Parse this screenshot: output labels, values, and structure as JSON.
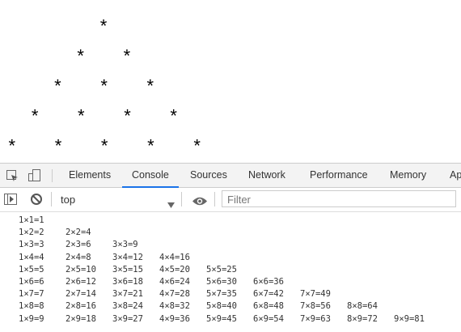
{
  "page": {
    "star_char": "*",
    "star_rows": [
      1,
      2,
      3,
      4,
      5
    ]
  },
  "devtools": {
    "tabs": [
      {
        "label": "Elements",
        "active": false
      },
      {
        "label": "Console",
        "active": true
      },
      {
        "label": "Sources",
        "active": false
      },
      {
        "label": "Network",
        "active": false
      },
      {
        "label": "Performance",
        "active": false
      },
      {
        "label": "Memory",
        "active": false
      },
      {
        "label": "Ap",
        "active": false
      }
    ],
    "toolbar": {
      "context": "top",
      "filter_placeholder": "Filter"
    },
    "accent": "#1a73e8",
    "console_lines": [
      [
        "1×1=1"
      ],
      [
        "1×2=2",
        "2×2=4"
      ],
      [
        "1×3=3",
        "2×3=6",
        "3×3=9"
      ],
      [
        "1×4=4",
        "2×4=8",
        "3×4=12",
        "4×4=16"
      ],
      [
        "1×5=5",
        "2×5=10",
        "3×5=15",
        "4×5=20",
        "5×5=25"
      ],
      [
        "1×6=6",
        "2×6=12",
        "3×6=18",
        "4×6=24",
        "5×6=30",
        "6×6=36"
      ],
      [
        "1×7=7",
        "2×7=14",
        "3×7=21",
        "4×7=28",
        "5×7=35",
        "6×7=42",
        "7×7=49"
      ],
      [
        "1×8=8",
        "2×8=16",
        "3×8=24",
        "4×8=32",
        "5×8=40",
        "6×8=48",
        "7×8=56",
        "8×8=64"
      ],
      [
        "1×9=9",
        "2×9=18",
        "3×9=27",
        "4×9=36",
        "5×9=45",
        "6×9=54",
        "7×9=63",
        "8×9=72",
        "9×9=81"
      ]
    ]
  }
}
